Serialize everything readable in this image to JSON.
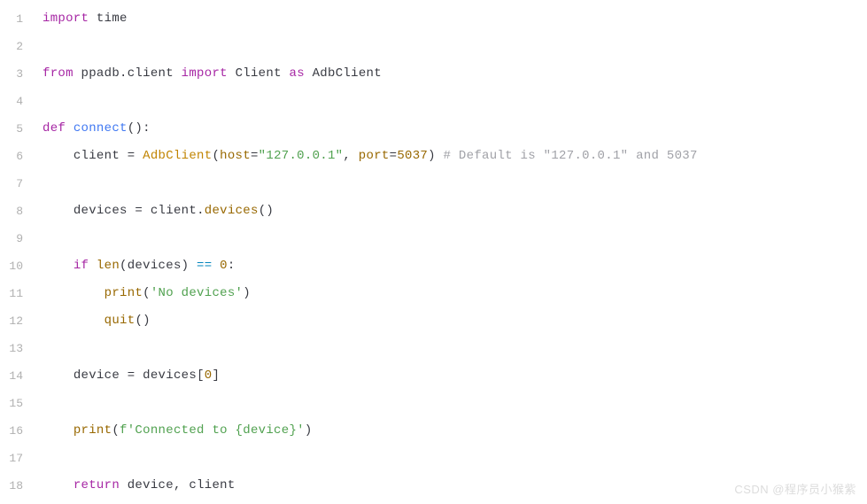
{
  "lines": {
    "numbers": [
      "1",
      "2",
      "3",
      "4",
      "5",
      "6",
      "7",
      "8",
      "9",
      "10",
      "11",
      "12",
      "13",
      "14",
      "15",
      "16",
      "17",
      "18"
    ]
  },
  "code": {
    "l1": {
      "kw": "import",
      "mod": "time"
    },
    "l3": {
      "from": "from",
      "mod": "ppadb",
      "dot": ".",
      "sub": "client",
      "imp": "import",
      "cls": "Client",
      "as": "as",
      "alias": "AdbClient"
    },
    "l5": {
      "def": "def",
      "name": "connect",
      "parens": "():"
    },
    "l6": {
      "indent": "    ",
      "var": "client",
      "eq": " = ",
      "cls": "AdbClient",
      "open": "(",
      "arg1k": "host",
      "arg1e": "=",
      "arg1v": "\"127.0.0.1\"",
      "comma": ", ",
      "arg2k": "port",
      "arg2e": "=",
      "arg2v": "5037",
      "close": ")",
      "cmt": " # Default is \"127.0.0.1\" and 5037"
    },
    "l8": {
      "indent": "    ",
      "var": "devices",
      "eq": " = ",
      "obj": "client",
      "dot": ".",
      "meth": "devices",
      "parens": "()"
    },
    "l10": {
      "indent": "    ",
      "if": "if",
      "sp": " ",
      "fn": "len",
      "open": "(",
      "arg": "devices",
      "close": ")",
      "op": " == ",
      "num": "0",
      "colon": ":"
    },
    "l11": {
      "indent": "        ",
      "fn": "print",
      "open": "(",
      "str": "'No devices'",
      "close": ")"
    },
    "l12": {
      "indent": "        ",
      "fn": "quit",
      "parens": "()"
    },
    "l14": {
      "indent": "    ",
      "var": "device",
      "eq": " = ",
      "arr": "devices",
      "open": "[",
      "idx": "0",
      "close": "]"
    },
    "l16": {
      "indent": "    ",
      "fn": "print",
      "open": "(",
      "pfx": "f",
      "str": "'Connected to {device}'",
      "close": ")"
    },
    "l18": {
      "indent": "    ",
      "ret": "return",
      "sp": " ",
      "v1": "device",
      "comma": ", ",
      "v2": "client"
    }
  },
  "watermark": "CSDN @程序员小猴紫"
}
